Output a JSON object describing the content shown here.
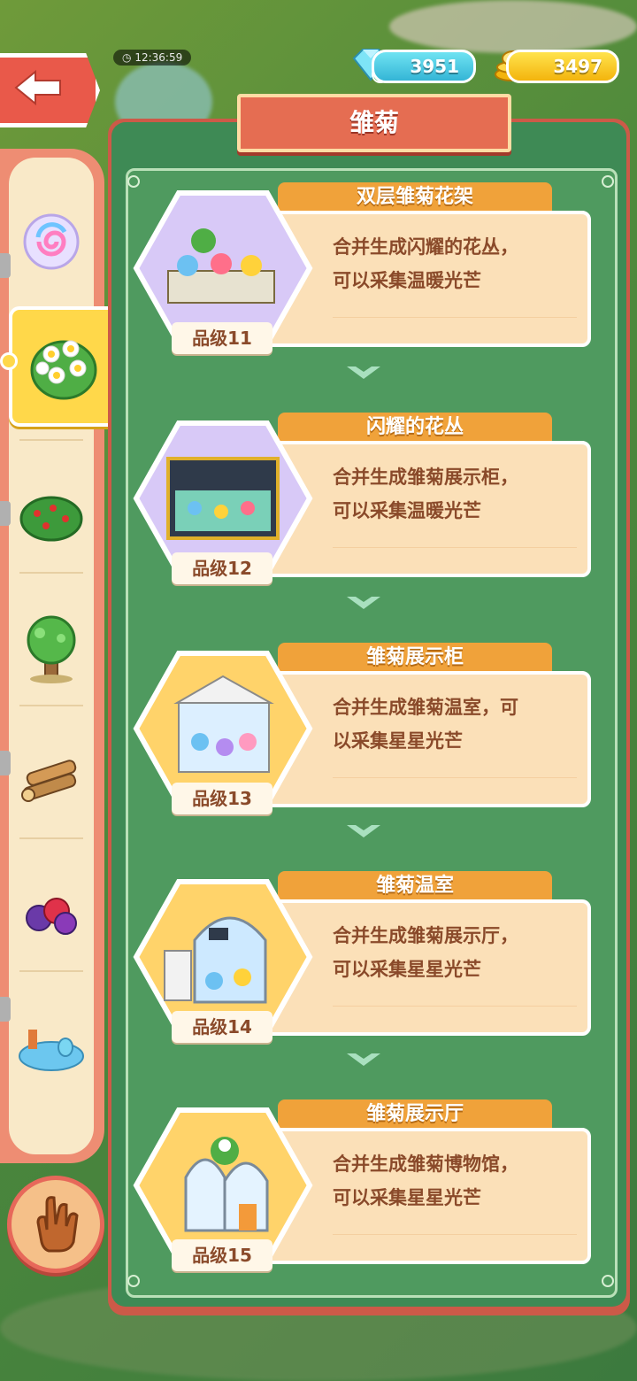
{
  "header": {
    "clock": "12:36:59",
    "gems": "3951",
    "gold": "3497"
  },
  "panel": {
    "title": "雏菊"
  },
  "sidebar": {
    "items": [
      {
        "name": "swirl-orb-icon"
      },
      {
        "name": "daisy-bush-icon",
        "selected": true
      },
      {
        "name": "berry-bush-icon"
      },
      {
        "name": "tree-icon"
      },
      {
        "name": "logs-icon"
      },
      {
        "name": "berries-icon"
      },
      {
        "name": "pond-icon"
      }
    ]
  },
  "items": [
    {
      "header": "双层雏菊花架",
      "desc_line1": "合并生成闪耀的花丛，",
      "desc_line2": "可以采集温暖光芒",
      "grade": "品级11",
      "theme": "purple"
    },
    {
      "header": "闪耀的花丛",
      "desc_line1": "合并生成雏菊展示柜，",
      "desc_line2": "可以采集温暖光芒",
      "grade": "品级12",
      "theme": "purple"
    },
    {
      "header": "雏菊展示柜",
      "desc_line1": "合并生成雏菊温室，可",
      "desc_line2": "以采集星星光芒",
      "grade": "品级13",
      "theme": "gold"
    },
    {
      "header": "雏菊温室",
      "desc_line1": "合并生成雏菊展示厅，",
      "desc_line2": "可以采集星星光芒",
      "grade": "品级14",
      "theme": "gold"
    },
    {
      "header": "雏菊展示厅",
      "desc_line1": "合并生成雏菊博物馆，",
      "desc_line2": "可以采集星星光芒",
      "grade": "品级15",
      "theme": "gold"
    }
  ],
  "colors": {
    "panel_green": "#3e8a55",
    "panel_border": "#cc5a48",
    "card_bg": "#fbe0b8",
    "card_header": "#f0a23a",
    "text_brown": "#8a4a2a",
    "gem": "#34b5d6",
    "gold": "#f3b40d",
    "hex_purple": "#c9b6f0",
    "hex_gold": "#ffd36a"
  }
}
